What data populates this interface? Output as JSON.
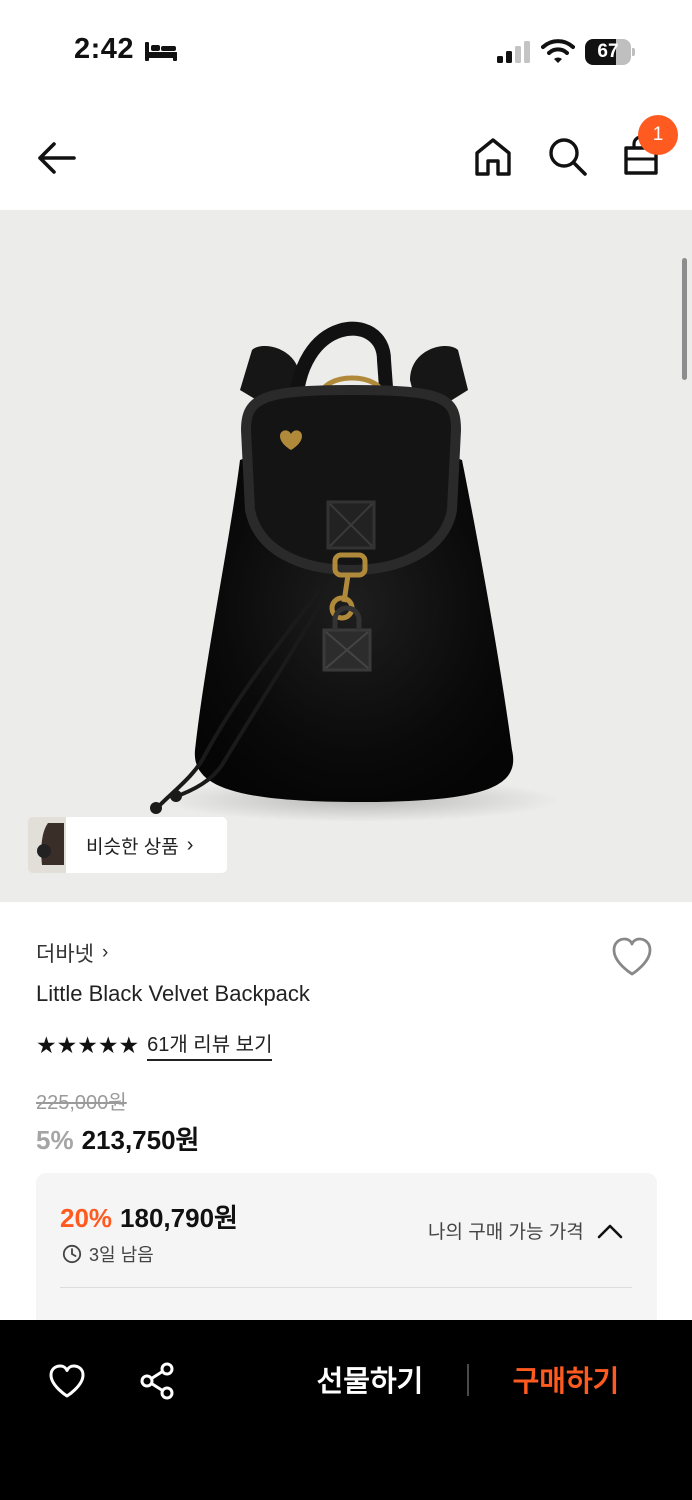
{
  "status_bar": {
    "time": "2:42",
    "battery": "67",
    "battery_level": 0.67
  },
  "header": {
    "cart_count": "1"
  },
  "image": {
    "similar_label": "비슷한 상품",
    "similar_chevron": "›"
  },
  "product": {
    "brand": "더바넷",
    "brand_chevron": "›",
    "title": "Little Black Velvet Backpack",
    "stars": "★★★★★",
    "rating": 5,
    "review_link": "61개 리뷰 보기",
    "original_price": "225,000원",
    "discount_rate": "5%",
    "sale_price": "213,750원"
  },
  "coupon": {
    "rate": "20%",
    "price": "180,790원",
    "time_left": "3일 남음",
    "my_price_label": "나의 구매 가능 가격"
  },
  "bottom_bar": {
    "gift_label": "선물하기",
    "buy_label": "구매하기"
  },
  "colors": {
    "accent": "#ff5a1f",
    "image_bg": "#ececea",
    "bottom_bar_bg": "#000000"
  },
  "icons": [
    "bed-icon",
    "signal-icon",
    "wifi-icon",
    "back-icon",
    "home-icon",
    "search-icon",
    "bag-icon",
    "heart-icon",
    "clock-icon",
    "chevron-up-icon",
    "share-icon"
  ]
}
